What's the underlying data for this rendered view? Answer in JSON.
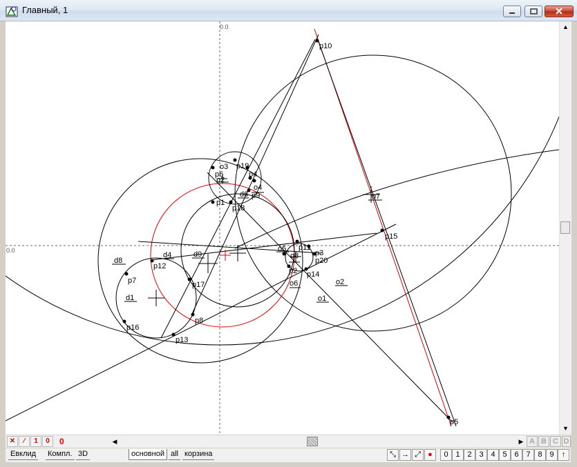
{
  "window": {
    "title": "Главный, 1"
  },
  "canvas": {
    "origin_label_x": "0.0",
    "origin_label_y": "0.0",
    "labels": {
      "p10": "p10",
      "p15": "p15",
      "p5": "p5",
      "o7": "o7",
      "o3": "o3",
      "p19": "p19",
      "p6": "p6",
      "o2": "o2",
      "p4": "p4",
      "o4": "o4",
      "d6": "d6",
      "p9": "p9",
      "p1": "p1",
      "p18": "p18",
      "o5": "o5",
      "p11": "p11",
      "o8": "o8",
      "p3": "p3",
      "p20": "p20",
      "p2": "p2",
      "o6": "o6",
      "p14": "p14",
      "o2b": "o2",
      "o1": "o1",
      "d8": "d8",
      "d4": "d4",
      "d9": "d9",
      "p12": "p12",
      "p7": "p7",
      "p17": "p17",
      "d1": "d1",
      "p8": "p8",
      "p16": "p16",
      "p13": "p13"
    }
  },
  "toolbar": {
    "counter": "0",
    "btn_small_1": "1",
    "btn_small_0": "0",
    "abcd": [
      "A",
      "B",
      "C",
      "D"
    ]
  },
  "tabs": {
    "left": [
      "Евклид",
      "Компл.",
      "3D"
    ],
    "right": [
      "основной",
      "all",
      "корзина"
    ],
    "active": "основной"
  },
  "numpad": [
    "0",
    "1",
    "2",
    "3",
    "4",
    "5",
    "6",
    "7",
    "8",
    "9",
    "↑"
  ]
}
